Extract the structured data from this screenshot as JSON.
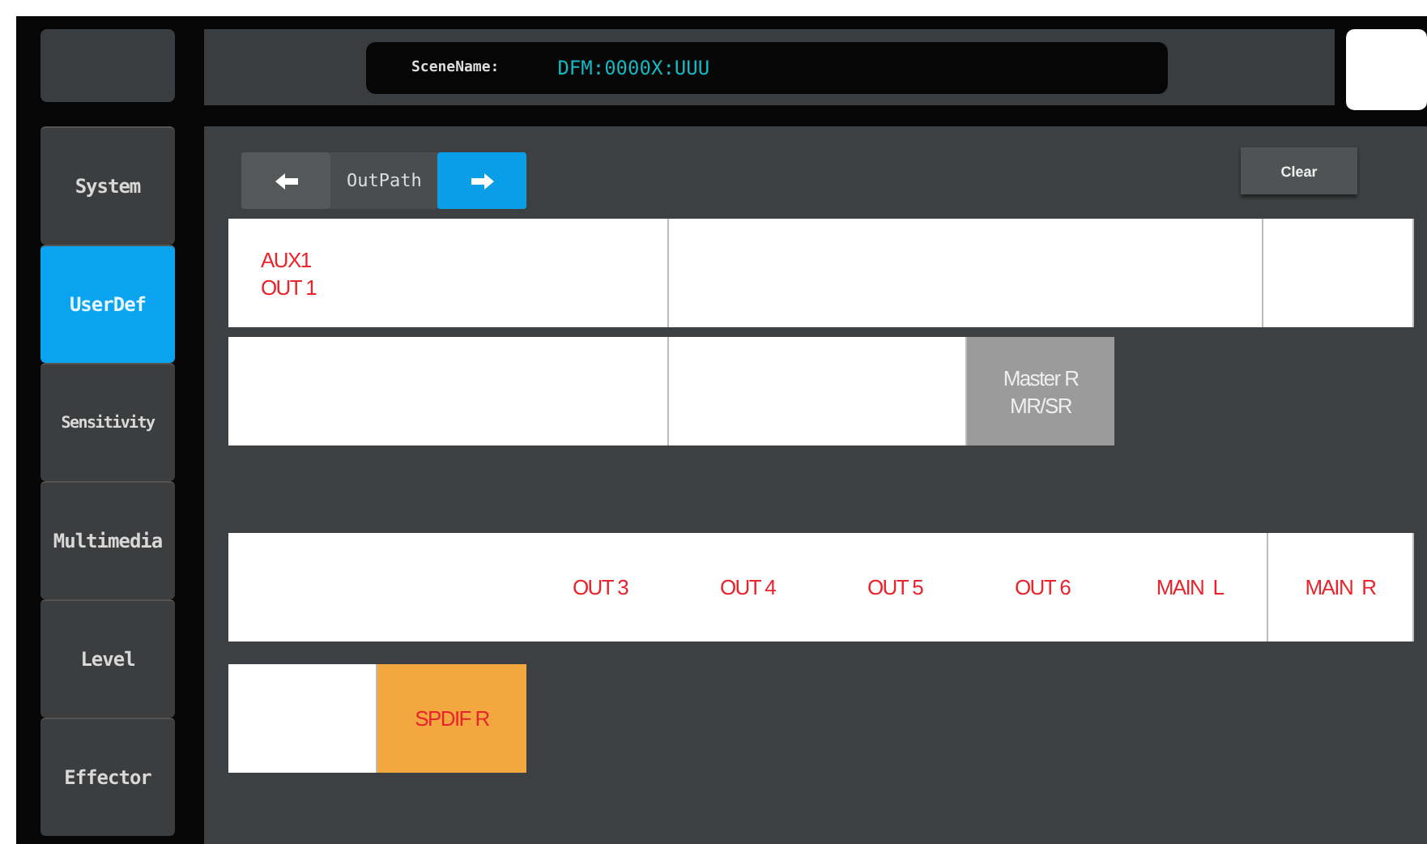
{
  "scene": {
    "label": "SceneName:",
    "value": "DFM:0000X:UUU"
  },
  "sidebar": {
    "items": [
      {
        "label": "System",
        "selected": false
      },
      {
        "label": "UserDef",
        "selected": true
      },
      {
        "label": "Sensitivity",
        "selected": false
      },
      {
        "label": "Multimedia",
        "selected": false
      },
      {
        "label": "Level",
        "selected": false
      },
      {
        "label": "Effector",
        "selected": false
      }
    ]
  },
  "path_nav": {
    "label": "OutPath",
    "arrows": [
      {
        "kind": "left",
        "selected": false
      },
      {
        "kind": "right",
        "selected": true
      }
    ]
  },
  "clear_button": "Clear",
  "rows": [
    {
      "cells": [
        {
          "kind": "plain",
          "labels": [
            "AUX1",
            "OUT 1"
          ]
        },
        {
          "kind": "plain"
        },
        {
          "kind": "plain"
        }
      ]
    },
    {
      "cells": [
        {
          "kind": "plain"
        },
        {
          "kind": "plain"
        },
        {
          "kind": "gray",
          "labels": [
            "Master R",
            "MR/SR"
          ]
        }
      ]
    },
    {
      "cells": [
        {
          "kind": "plain",
          "labels": [
            "OUT 3",
            "OUT 4",
            "OUT 5",
            "OUT 6",
            "MAIN  L"
          ]
        },
        {
          "kind": "plain",
          "labels": [
            "MAIN  R"
          ]
        }
      ]
    },
    {
      "cells": [
        {
          "kind": "plain"
        },
        {
          "kind": "orange",
          "labels": [
            "SPDIF R"
          ]
        }
      ]
    }
  ]
}
